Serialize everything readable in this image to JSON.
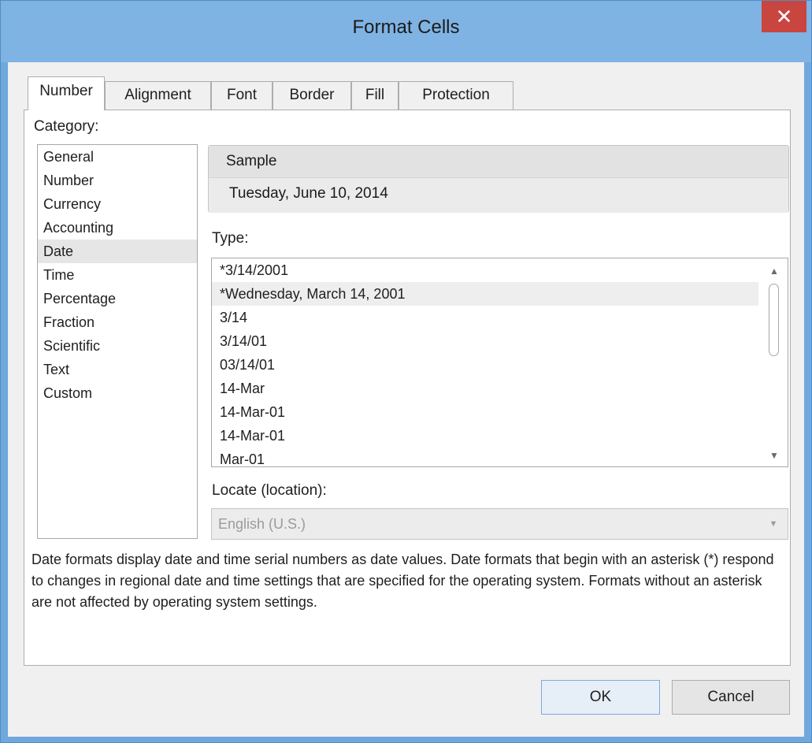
{
  "window": {
    "title": "Format Cells",
    "close_label": "✕"
  },
  "tabs": [
    {
      "label": "Number",
      "active": true
    },
    {
      "label": "Alignment",
      "active": false
    },
    {
      "label": "Font",
      "active": false
    },
    {
      "label": "Border",
      "active": false
    },
    {
      "label": "Fill",
      "active": false
    },
    {
      "label": "Protection",
      "active": false
    }
  ],
  "category": {
    "label": "Category:",
    "items": [
      "General",
      "Number",
      "Currency",
      "Accounting",
      "Date",
      "Time",
      "Percentage",
      "Fraction",
      "Scientific",
      "Text",
      "Custom"
    ],
    "selected": "Date"
  },
  "sample": {
    "label": "Sample",
    "value": "Tuesday, June 10, 2014"
  },
  "type": {
    "label": "Type:",
    "items": [
      "*3/14/2001",
      "*Wednesday, March 14, 2001",
      "3/14",
      "3/14/01",
      "03/14/01",
      "14-Mar",
      "14-Mar-01",
      "14-Mar-01",
      "Mar-01"
    ],
    "selected": "*Wednesday, March 14, 2001"
  },
  "locale": {
    "label": "Locate (location):",
    "value": "English (U.S.)"
  },
  "description": "Date formats display date and time serial numbers as date values. Date formats that begin with an asterisk (*) respond to changes in regional date and time settings that are specified for the operating system. Formats without an asterisk are not affected by operating system settings.",
  "buttons": {
    "ok": "OK",
    "cancel": "Cancel"
  }
}
